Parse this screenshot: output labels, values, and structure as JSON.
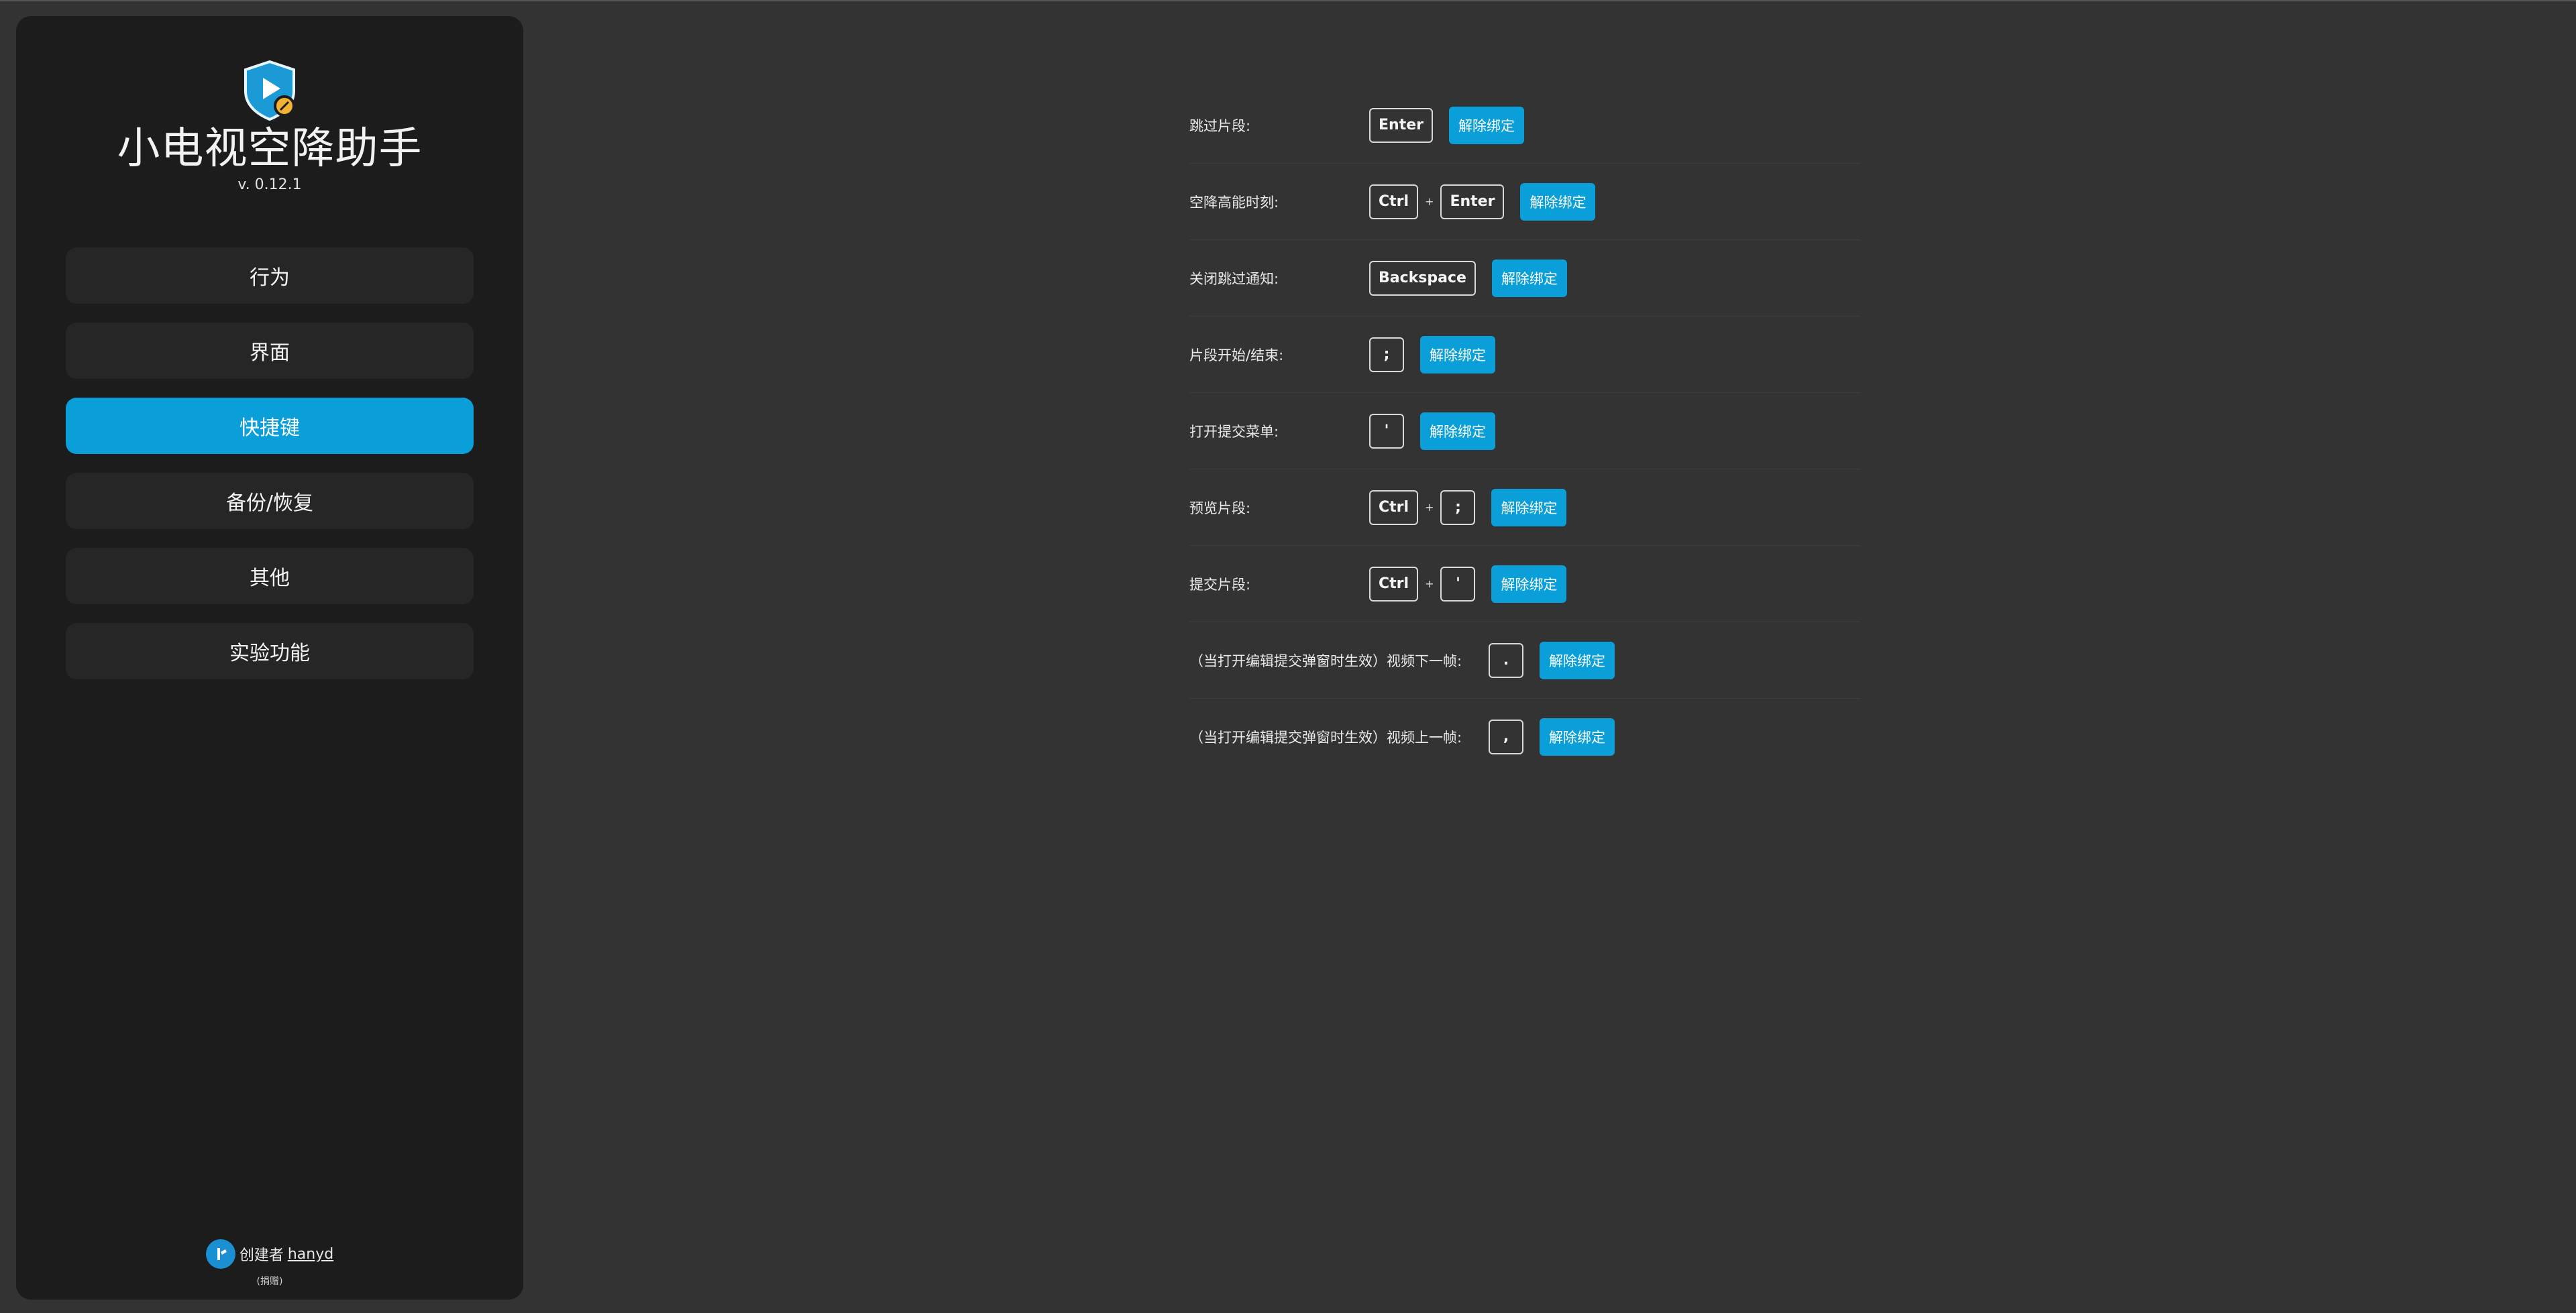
{
  "app": {
    "title": "小电视空降助手",
    "version": "v. 0.12.1"
  },
  "nav": [
    {
      "label": "行为",
      "active": false
    },
    {
      "label": "界面",
      "active": false
    },
    {
      "label": "快捷键",
      "active": true
    },
    {
      "label": "备份/恢复",
      "active": false
    },
    {
      "label": "其他",
      "active": false
    },
    {
      "label": "实验功能",
      "active": false
    }
  ],
  "credit": {
    "prefix": "创建者",
    "author": "hanyd",
    "sub": "(捐赠)"
  },
  "unbind_label": "解除绑定",
  "shortcuts": [
    {
      "label": "跳过片段:",
      "keys": [
        "Enter"
      ]
    },
    {
      "label": "空降高能时刻:",
      "keys": [
        "Ctrl",
        "Enter"
      ]
    },
    {
      "label": "关闭跳过通知:",
      "keys": [
        "Backspace"
      ]
    },
    {
      "label": "片段开始/结束:",
      "keys": [
        ";"
      ]
    },
    {
      "label": "打开提交菜单:",
      "keys": [
        "'"
      ]
    },
    {
      "label": "预览片段:",
      "keys": [
        "Ctrl",
        ";"
      ]
    },
    {
      "label": "提交片段:",
      "keys": [
        "Ctrl",
        "'"
      ]
    },
    {
      "label": "（当打开编辑提交弹窗时生效）视频下一帧:",
      "keys": [
        "."
      ],
      "wide": true
    },
    {
      "label": "（当打开编辑提交弹窗时生效）视频上一帧:",
      "keys": [
        ","
      ],
      "wide": true
    }
  ],
  "colors": {
    "accent": "#0a9fd9",
    "sidebar_bg": "#1c1c1c",
    "page_bg": "#333333"
  },
  "icons": {
    "logo": "tv-play-shield-logo",
    "credit": "user-avatar-icon"
  }
}
